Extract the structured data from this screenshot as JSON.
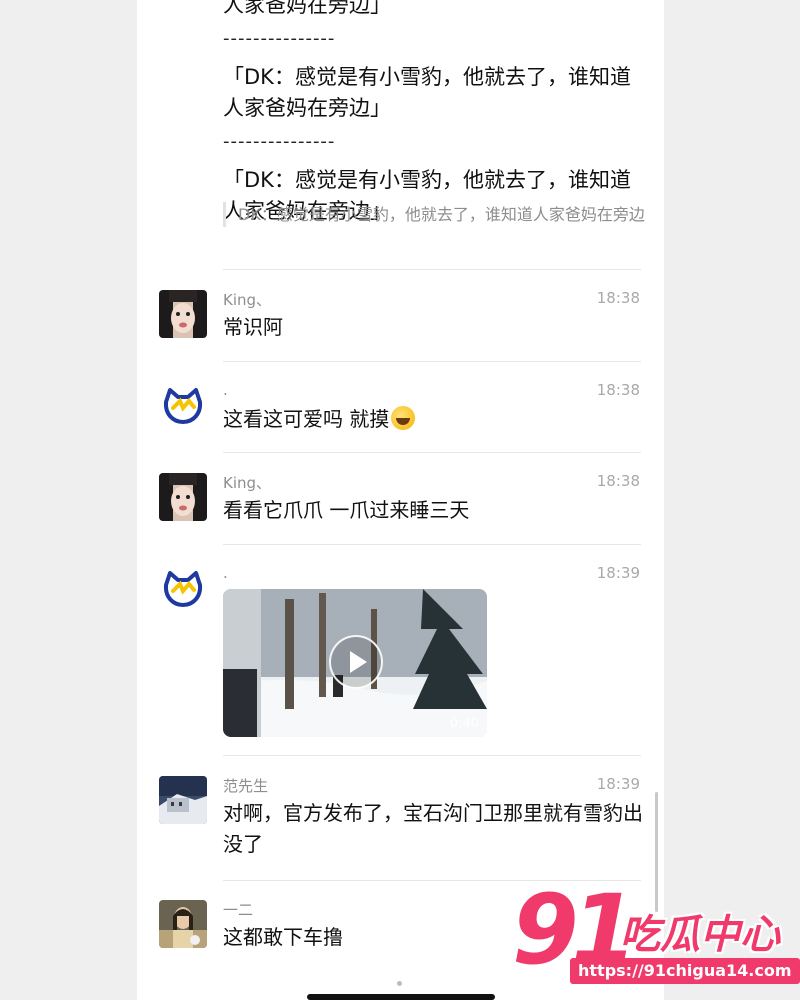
{
  "quote_block": {
    "lines": [
      "人家爸妈在旁边」",
      "---------------",
      "「DK：感觉是有小雪豹，他就去了，谁知道",
      "人家爸妈在旁边」",
      "---------------",
      "「DK：感觉是有小雪豹，他就去了，谁知道",
      "人家爸妈在旁边」"
    ],
    "reference": "DK：感觉是有小雪豹，他就去了，谁知道人家爸妈在旁边"
  },
  "messages": [
    {
      "name": "King、",
      "time": "18:38",
      "text": "常识阿"
    },
    {
      "name": ".",
      "time": "18:38",
      "text": "这看这可爱吗 就摸",
      "emoji": "laughing-crying-emoji"
    },
    {
      "name": "King、",
      "time": "18:38",
      "text": "看看它爪爪 一爪过来睡三天"
    },
    {
      "name": ".",
      "time": "18:39",
      "video_duration": "0:40"
    },
    {
      "name": "范先生",
      "time": "18:39",
      "text": "对啊，官方发布了，宝石沟门卫那里就有雪豹出没了"
    },
    {
      "name": "一二",
      "time": "",
      "text": "这都敢下车撸"
    }
  ],
  "watermark": {
    "number": "91",
    "text": "吃瓜中心",
    "url": "https://91chigua14.com"
  },
  "colors": {
    "watermark": "#f03a6b",
    "avatar_cat": "#1e3aa0",
    "background": "#efefef"
  }
}
